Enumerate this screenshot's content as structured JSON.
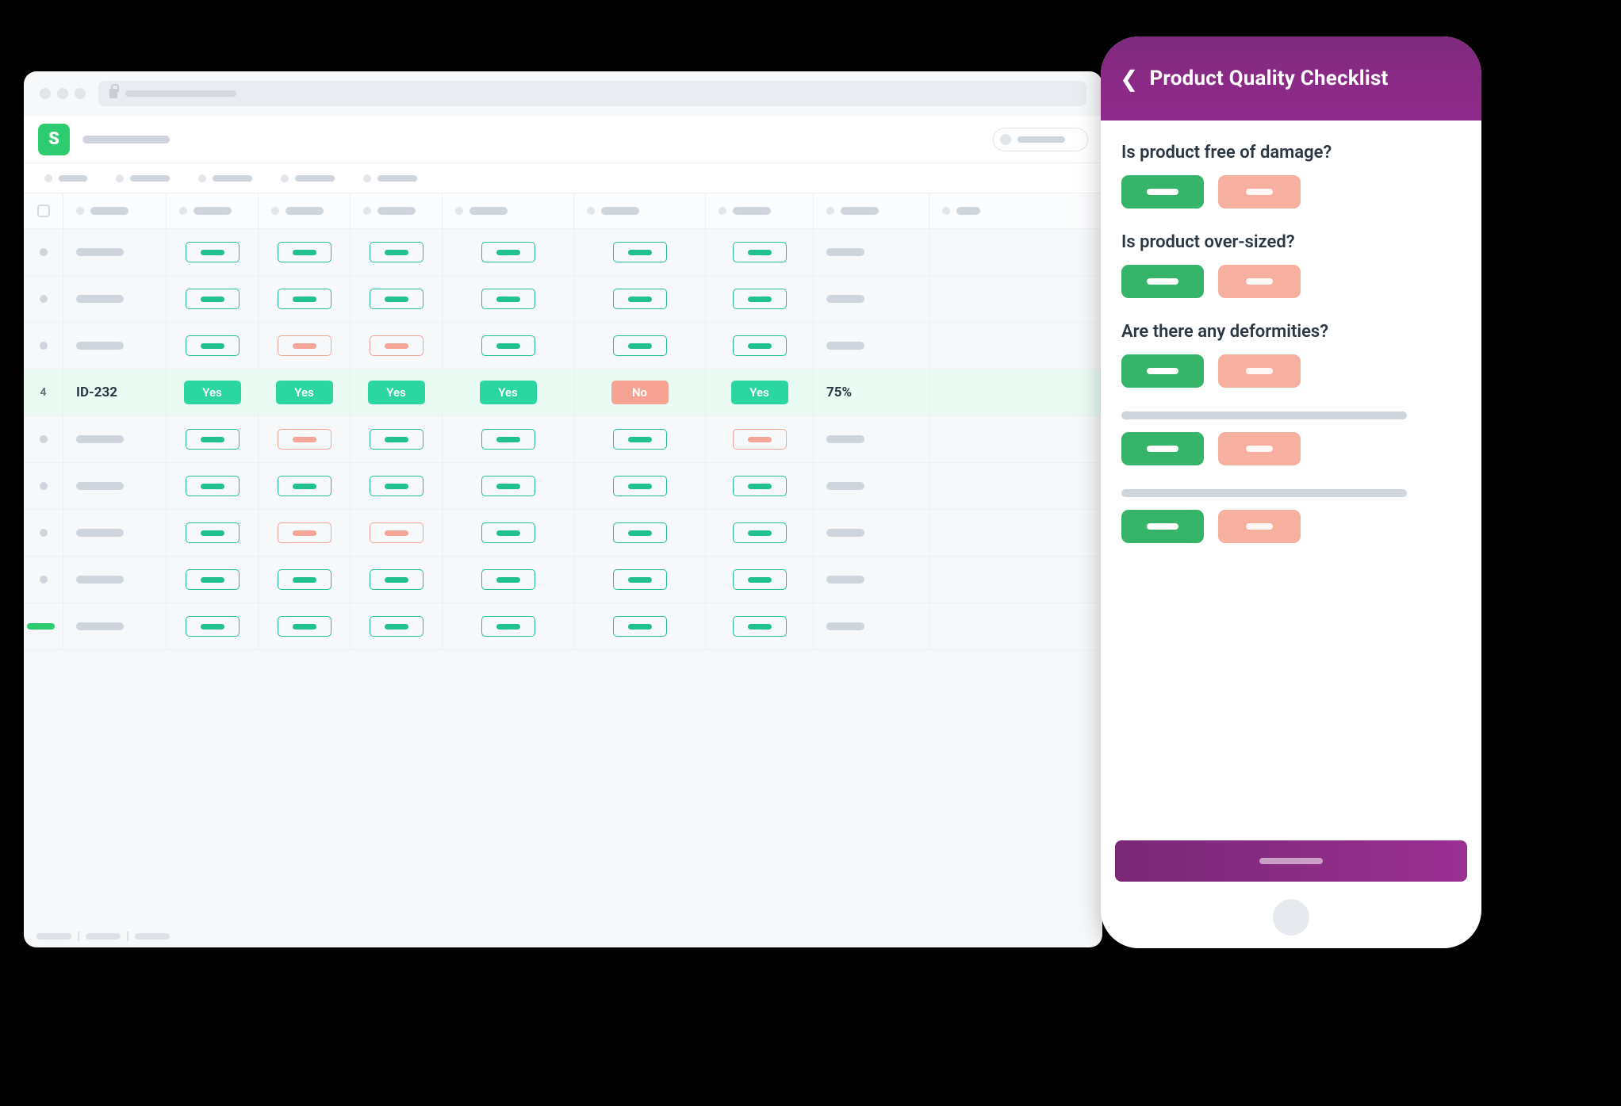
{
  "browser": {
    "logo_letter": "S"
  },
  "table": {
    "active_row": {
      "index": "4",
      "id": "ID-232",
      "cells": [
        "Yes",
        "Yes",
        "Yes",
        "Yes",
        "No",
        "Yes"
      ],
      "score": "75%"
    },
    "rows_above_count": 3,
    "rows_below_count": 5,
    "generic_rows": [
      [
        "green",
        "green",
        "green",
        "green",
        "green",
        "green"
      ],
      [
        "green",
        "green",
        "green",
        "green",
        "green",
        "green"
      ],
      [
        "green",
        "red",
        "red",
        "green",
        "green",
        "green"
      ]
    ],
    "generic_rows_below": [
      [
        "green",
        "red",
        "green",
        "green",
        "green",
        "red"
      ],
      [
        "green",
        "green",
        "green",
        "green",
        "green",
        "green"
      ],
      [
        "green",
        "red",
        "red",
        "green",
        "green",
        "green"
      ],
      [
        "green",
        "green",
        "green",
        "green",
        "green",
        "green"
      ],
      [
        "green",
        "green",
        "green",
        "green",
        "green",
        "green"
      ]
    ]
  },
  "phone": {
    "title": "Product Quality Checklist",
    "questions": [
      {
        "text": "Is product free of damage?"
      },
      {
        "text": " Is product over-sized?"
      },
      {
        "text": "Are there any deformities?"
      },
      {
        "text": null
      },
      {
        "text": null
      }
    ]
  }
}
